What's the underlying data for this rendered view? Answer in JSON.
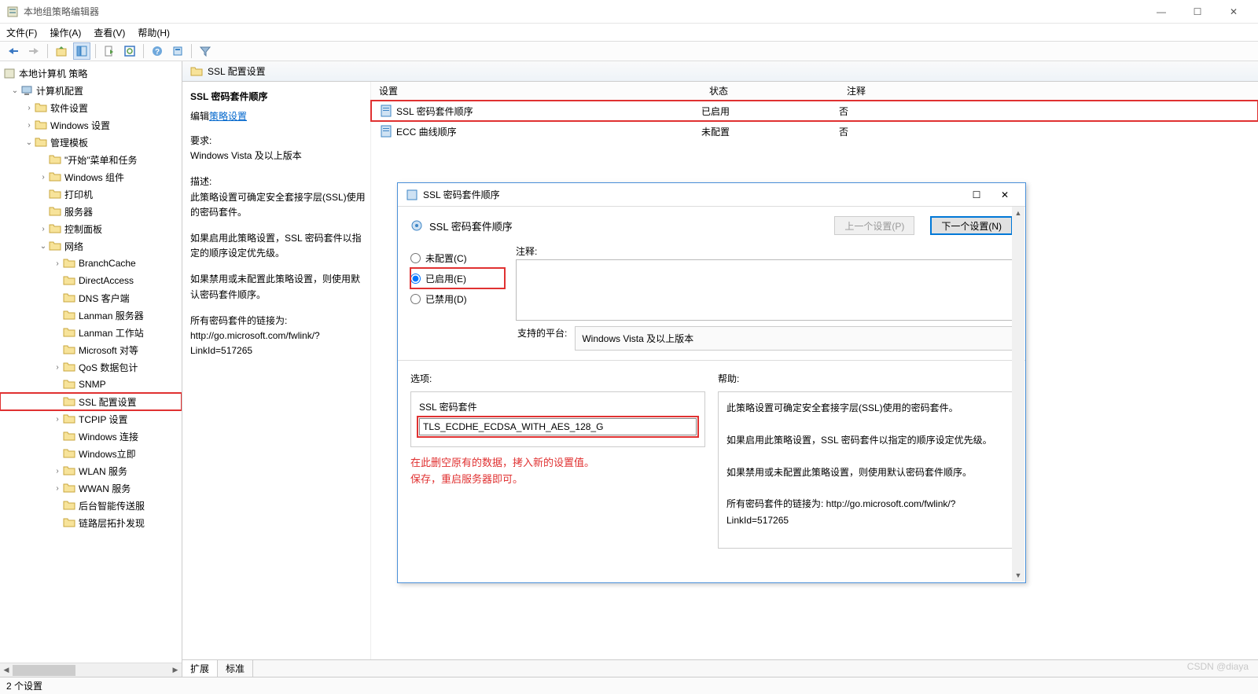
{
  "window": {
    "title": "本地组策略编辑器",
    "menu": {
      "file": "文件(F)",
      "action": "操作(A)",
      "view": "查看(V)",
      "help": "帮助(H)"
    }
  },
  "tree": {
    "root": "本地计算机 策略",
    "computer_config": "计算机配置",
    "software_settings": "软件设置",
    "windows_settings": "Windows 设置",
    "admin_templates": "管理模板",
    "start_menu": "\"开始\"菜单和任务",
    "windows_components": "Windows 组件",
    "printers": "打印机",
    "servers": "服务器",
    "control_panel": "控制面板",
    "network": "网络",
    "branchcache": "BranchCache",
    "directaccess": "DirectAccess",
    "dns_client": "DNS 客户端",
    "lanman_server": "Lanman 服务器",
    "lanman_workstation": "Lanman 工作站",
    "microsoft_peer": "Microsoft 对等",
    "qos": "QoS 数据包计",
    "snmp": "SNMP",
    "ssl_config": "SSL 配置设置",
    "tcpip": "TCPIP 设置",
    "windows_connect": "Windows 连接",
    "windows_now": "Windows立即",
    "wlan": "WLAN 服务",
    "wwan": "WWAN 服务",
    "background_intelligent": "后台智能传送服",
    "link_layer": "链路层拓扑发现"
  },
  "content": {
    "header": "SSL 配置设置",
    "title": "SSL 密码套件顺序",
    "edit_label": "编辑",
    "edit_link": "策略设置",
    "req_label": "要求:",
    "req_text": "Windows Vista 及以上版本",
    "desc_label": "描述:",
    "desc_text1": "此策略设置可确定安全套接字层(SSL)使用的密码套件。",
    "desc_text2": "如果启用此策略设置，SSL 密码套件以指定的顺序设定优先级。",
    "desc_text3": "如果禁用或未配置此策略设置，则使用默认密码套件顺序。",
    "desc_text4": "所有密码套件的链接为: http://go.microsoft.com/fwlink/?LinkId=517265",
    "columns": {
      "setting": "设置",
      "state": "状态",
      "comment": "注释"
    },
    "rows": [
      {
        "name": "SSL 密码套件顺序",
        "state": "已启用",
        "comment": "否"
      },
      {
        "name": "ECC 曲线顺序",
        "state": "未配置",
        "comment": "否"
      }
    ],
    "tabs": {
      "extended": "扩展",
      "standard": "标准"
    }
  },
  "dialog": {
    "title": "SSL 密码套件顺序",
    "header": "SSL 密码套件顺序",
    "prev_btn": "上一个设置(P)",
    "next_btn": "下一个设置(N)",
    "radio_notconfig": "未配置(C)",
    "radio_enabled": "已启用(E)",
    "radio_disabled": "已禁用(D)",
    "comment_label": "注释:",
    "platform_label": "支持的平台:",
    "platform_value": "Windows Vista 及以上版本",
    "options_label": "选项:",
    "help_label": "帮助:",
    "group_title": "SSL 密码套件",
    "cipher_value": "TLS_ECDHE_ECDSA_WITH_AES_128_G",
    "annotation1": "在此删空原有的数据，拷入新的设置值。",
    "annotation2": "保存，重启服务器即可。",
    "help_l1": "此策略设置可确定安全套接字层(SSL)使用的密码套件。",
    "help_l2": "如果启用此策略设置，SSL 密码套件以指定的顺序设定优先级。",
    "help_l3": "如果禁用或未配置此策略设置，则使用默认密码套件顺序。",
    "help_l4": "所有密码套件的链接为: http://go.microsoft.com/fwlink/?LinkId=517265"
  },
  "status": {
    "count": "2 个设置"
  },
  "watermark": "CSDN @diaya"
}
